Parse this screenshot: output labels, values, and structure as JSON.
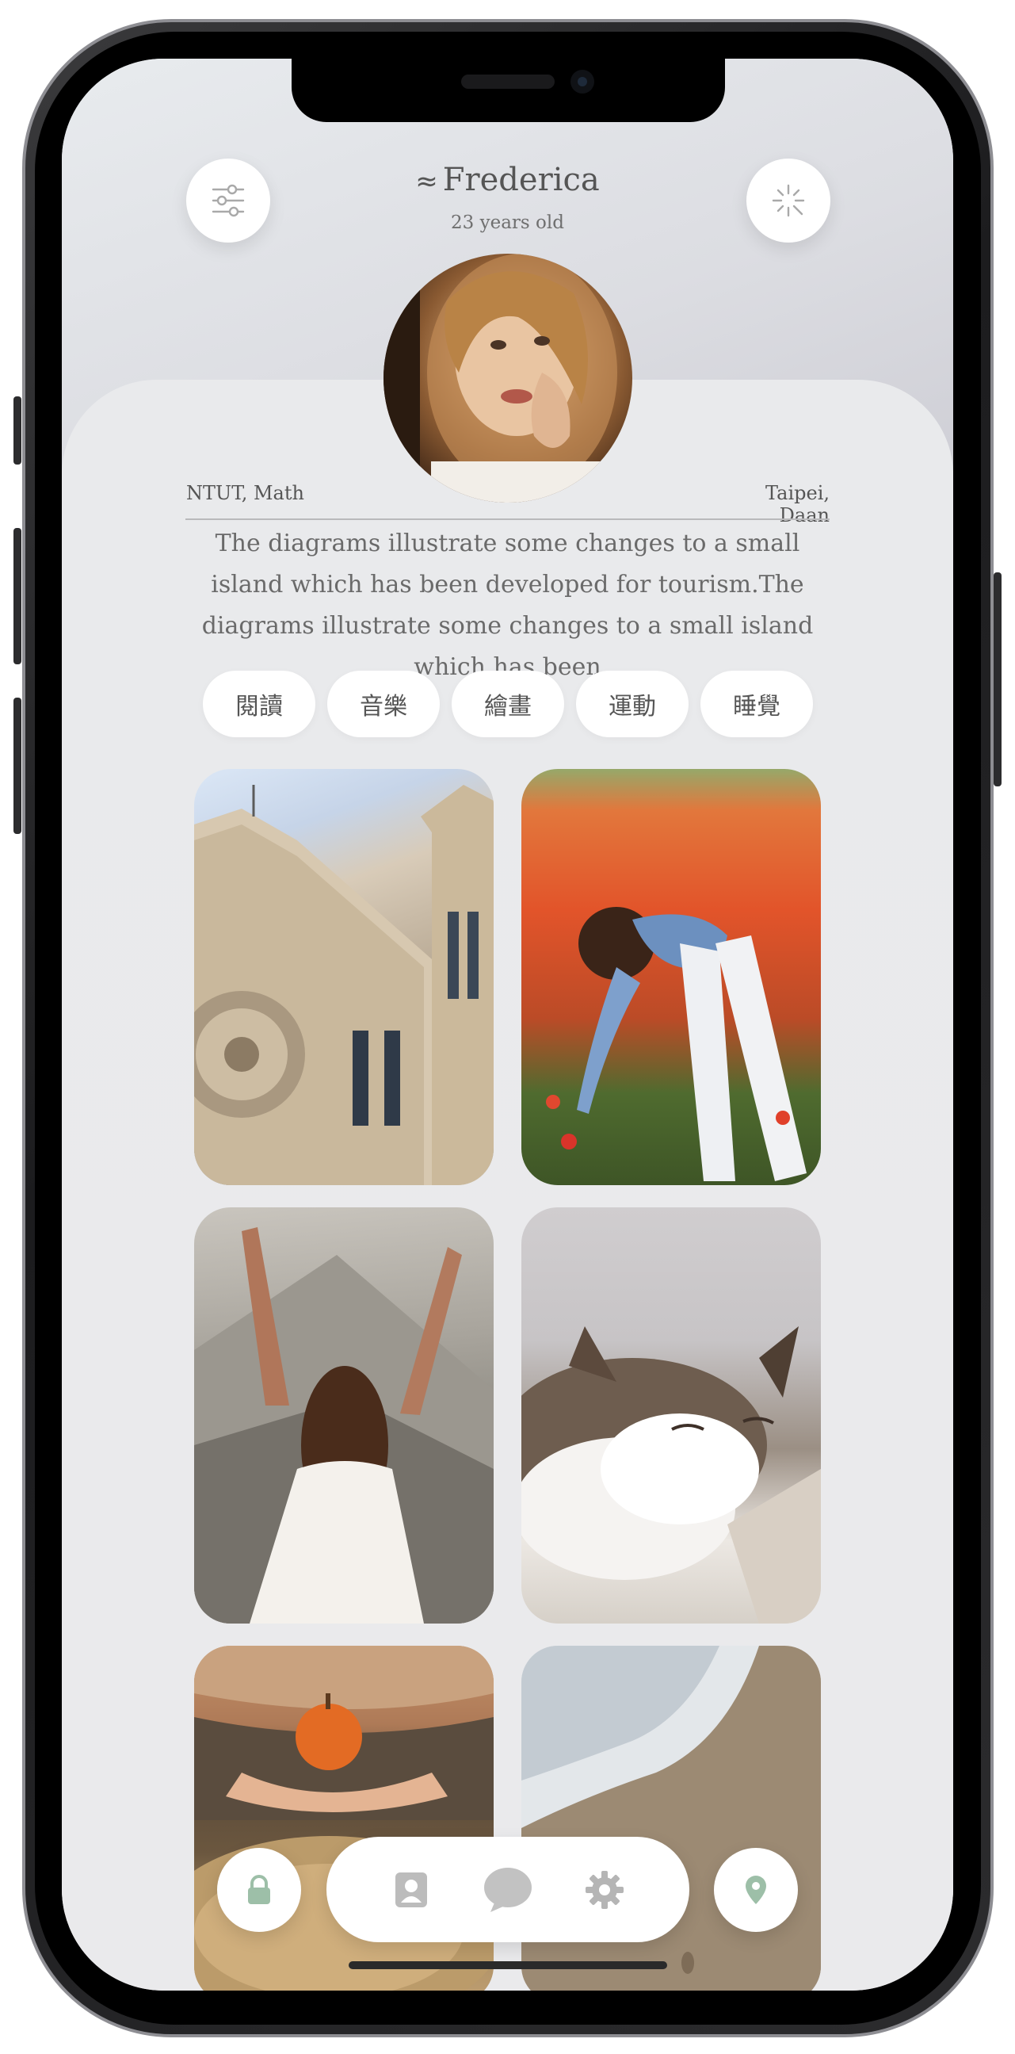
{
  "profile": {
    "name_prefix": "≈",
    "name": "Frederica",
    "age": "23 years old",
    "school": "NTUT, Math",
    "location": "Taipei, Daan",
    "bio": "The diagrams illustrate some changes to a small island which has been developed for tourism.The diagrams illustrate some changes to a small island which has been"
  },
  "tags": [
    "閱讀",
    "音樂",
    "繪畫",
    "運動",
    "睡覺"
  ],
  "photos": [
    "cathedral",
    "poppy-field",
    "mountain-arms-raised",
    "sleeping-cat",
    "orange-basket",
    "beach-waves"
  ],
  "header": {
    "left_icon": "sliders-icon",
    "right_icon": "sparkle-icon"
  },
  "nav": {
    "lock_icon": "lock-icon",
    "dock_icons": [
      "contact-icon",
      "chat-bubble-icon",
      "gear-icon"
    ],
    "pin_icon": "location-pin-icon"
  },
  "colors": {
    "accent_green": "#9dbfa8",
    "icon_gray": "#b9b9b9",
    "text": "#555555"
  }
}
